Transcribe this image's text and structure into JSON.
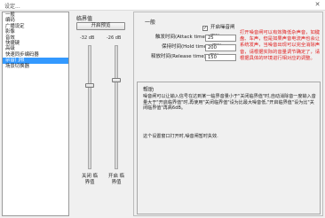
{
  "window": {
    "title": "设定...",
    "close_glyph": "✕"
  },
  "sidebar": {
    "items": [
      {
        "label": "一般",
        "selected": false
      },
      {
        "label": "编码",
        "selected": false
      },
      {
        "label": "广播设定",
        "selected": false
      },
      {
        "label": "影像",
        "selected": false
      },
      {
        "label": "音效",
        "selected": false
      },
      {
        "label": "快捷键",
        "selected": false
      },
      {
        "label": "高级",
        "selected": false
      },
      {
        "label": "快速同步编码器",
        "selected": false
      },
      {
        "label": "杂音门限",
        "selected": true
      },
      {
        "label": "场景切换器",
        "selected": false
      }
    ]
  },
  "mixer": {
    "title": "临界值",
    "enable_button": "开启预览",
    "left_db": "-32 dB",
    "right_db": "-26 dB",
    "left_label": "关闭 临界值",
    "right_label": "开启 临界值"
  },
  "general": {
    "title": "一般",
    "enable_label": "开启噪音闸",
    "enable_checked": true,
    "attack_label": "触发时间(Attack time) (毫秒) :",
    "attack_value": "25",
    "hold_label": "保持时间(Hold time) (毫秒) :",
    "hold_value": "200",
    "release_label": "释放时间(Release time) (毫秒) :",
    "release_value": "150",
    "note": "打开噪音闸可以有效降低杂声音，如键盘、车声，但是如果声音电流声也会让系统发声，当噪音出现可以完全消除声音，请根据实际的音量调节确定了，请根据具体的环境进行相对应的调整。"
  },
  "help": {
    "title": "帮助",
    "text1": "噪音闸可以让输入信号在达到某一临界音量小于\"关闭临界值\"时,自动消除音一度输入音量大于\"开启临界值\"时,再使用\"关闭临界值\"设为比最大噪音低,\"开启临界值\"设为比\"关闭临界值\"再高6dB。",
    "text2": "这个设置窗口打开时,噪音闸暂时失效."
  }
}
